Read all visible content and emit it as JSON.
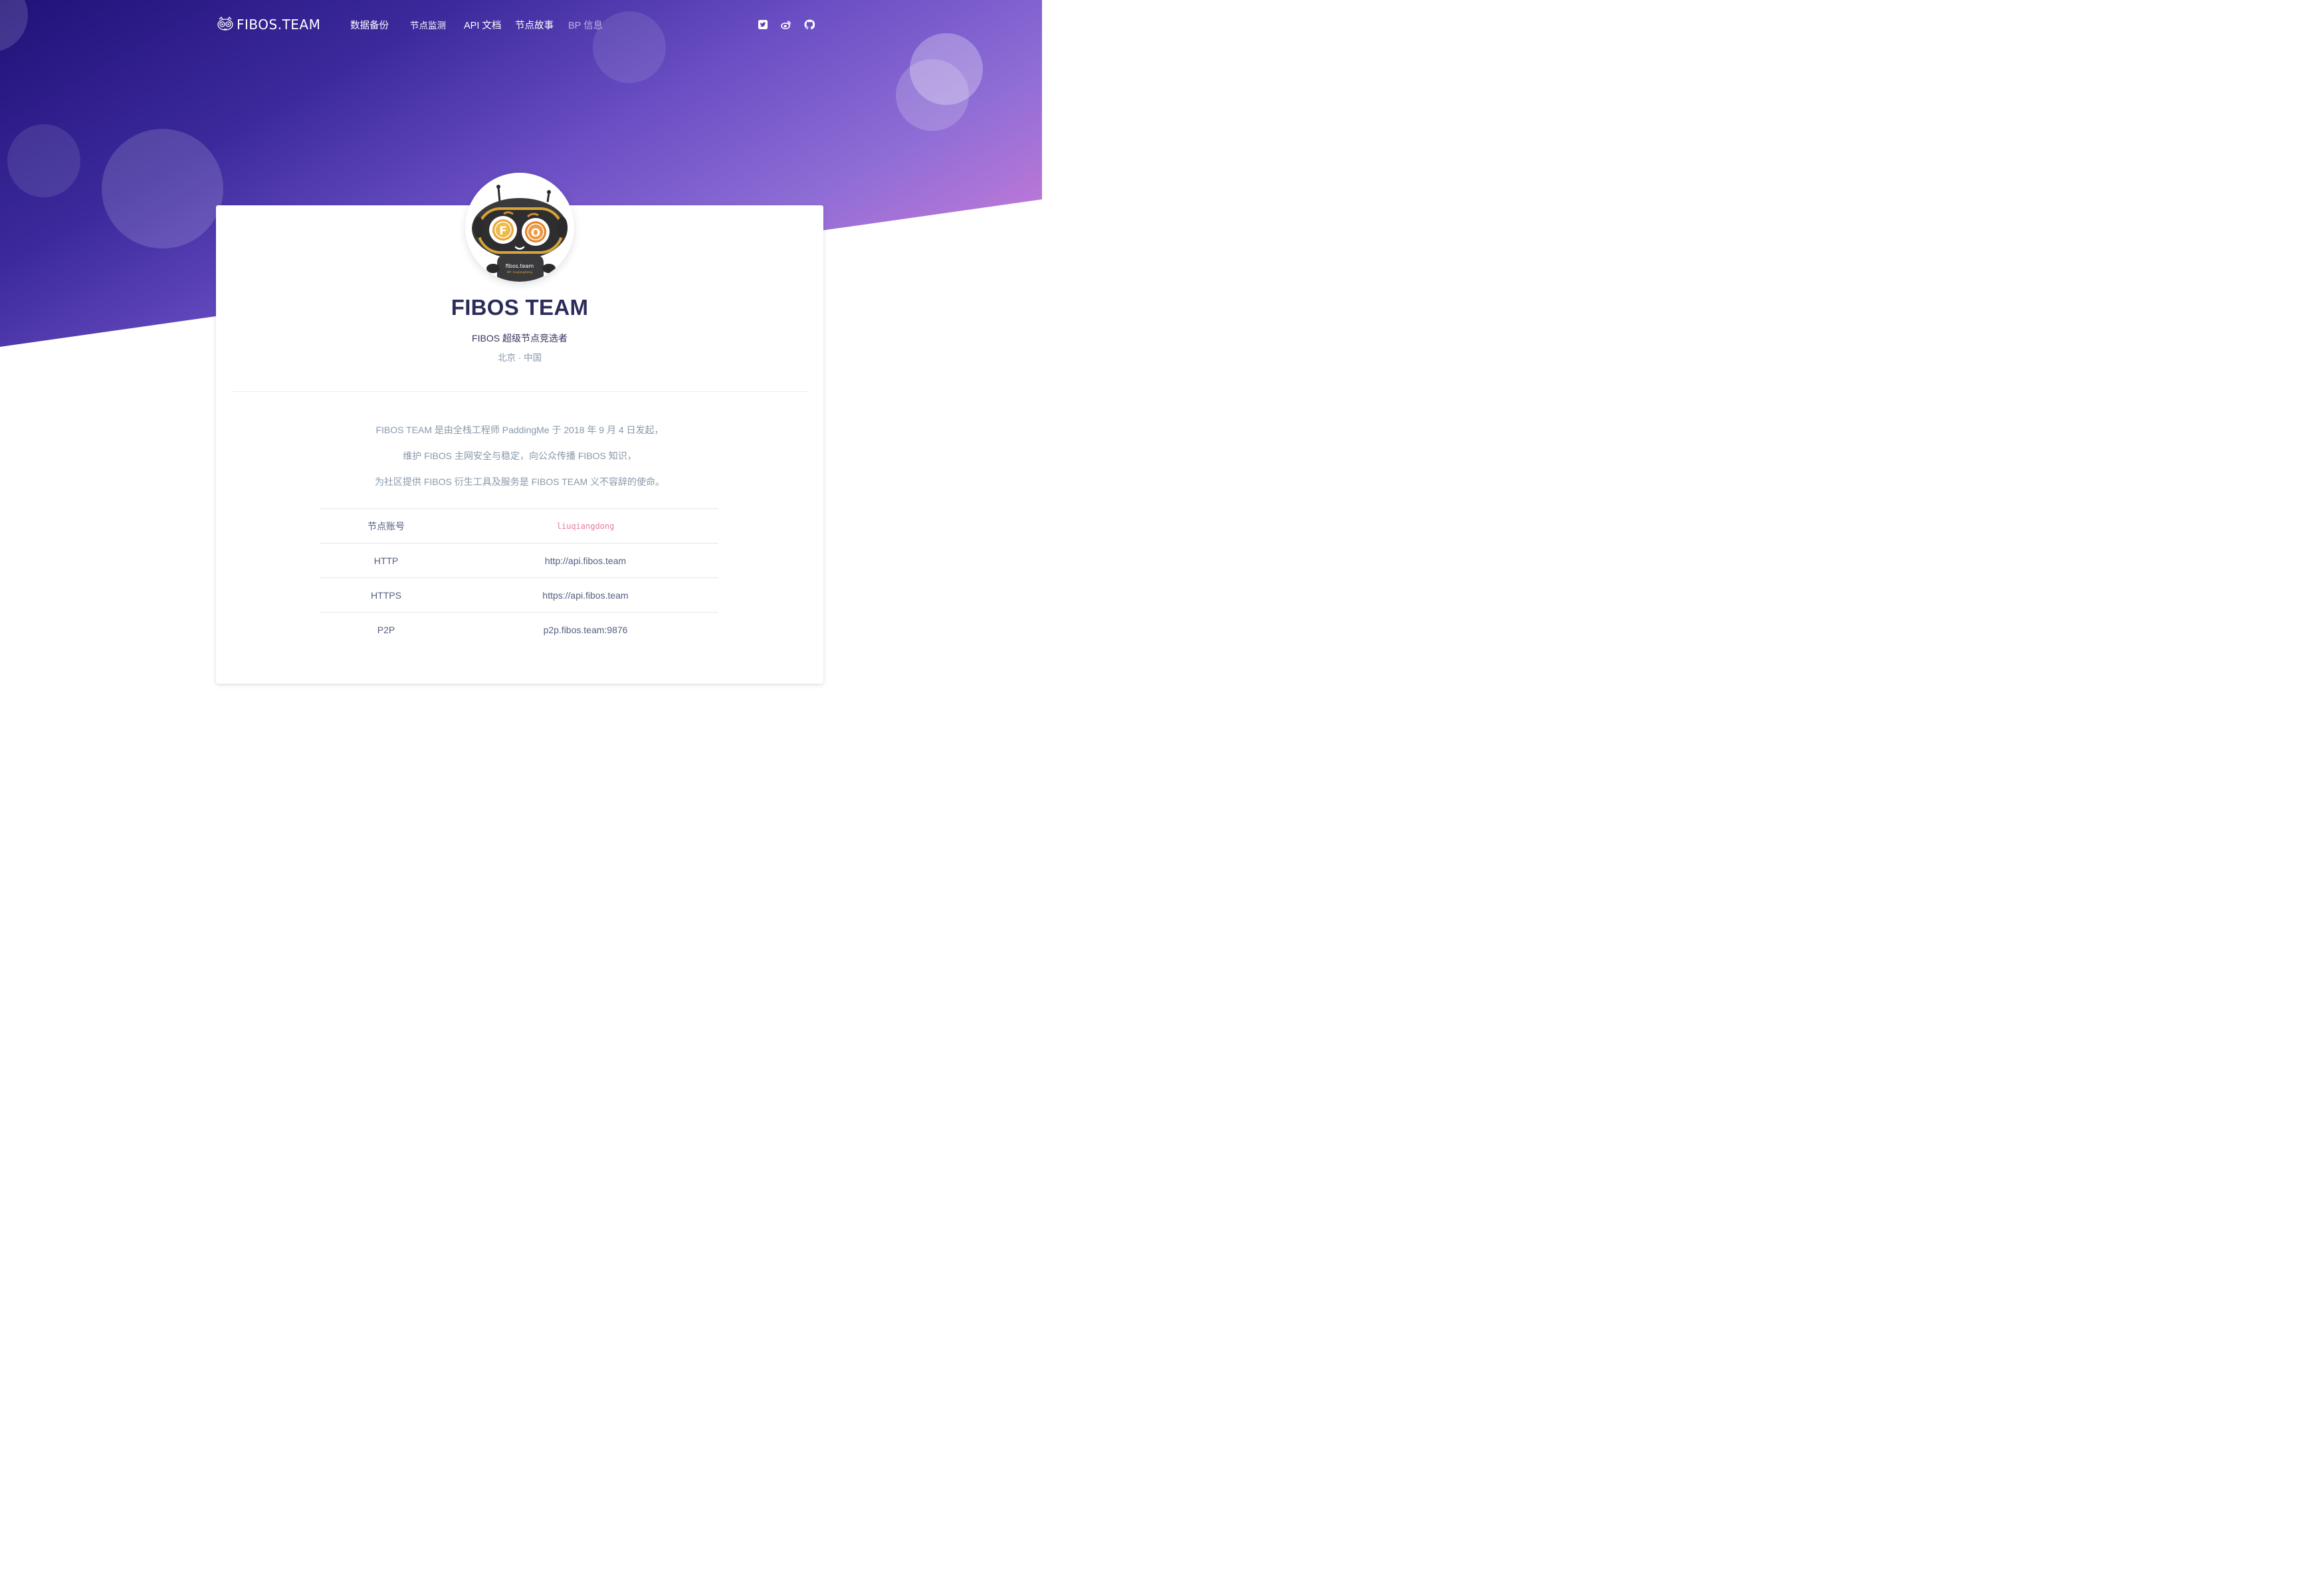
{
  "header": {
    "logo_text": "FIBOS.TEAM",
    "nav": [
      {
        "label": "数据备份"
      },
      {
        "label": "节点监测"
      },
      {
        "label": "API 文档"
      },
      {
        "label": "节点故事"
      },
      {
        "label": "BP 信息",
        "active": true
      }
    ],
    "social": [
      "twitter-icon",
      "weibo-icon",
      "github-icon"
    ]
  },
  "profile": {
    "avatar_label": "fibos.team",
    "avatar_sublabel": "BP: liuqiangdong",
    "avatar_coin_left": "F",
    "avatar_coin_right": "O",
    "title": "FIBOS TEAM",
    "subtitle": "FIBOS 超级节点竞选者",
    "location": "北京 · 中国"
  },
  "description": [
    "FIBOS TEAM 是由全栈工程师 PaddingMe 于 2018 年 9 月 4 日发起，",
    "维护 FIBOS 主网安全与稳定，向公众传播 FIBOS 知识，",
    "为社区提供 FIBOS 衍生工具及服务是 FIBOS TEAM 义不容辞的使命。"
  ],
  "info": [
    {
      "key": "节点账号",
      "value": "liuqiangdong"
    },
    {
      "key": "HTTP",
      "value": "http://api.fibos.team"
    },
    {
      "key": "HTTPS",
      "value": "https://api.fibos.team"
    },
    {
      "key": "P2P",
      "value": "p2p.fibos.team:9876"
    }
  ],
  "colors": {
    "gradient_start": "#201178",
    "gradient_end": "#de80d8",
    "title": "#2b2c5a",
    "muted": "#8898aa",
    "code": "#e67ba4"
  }
}
